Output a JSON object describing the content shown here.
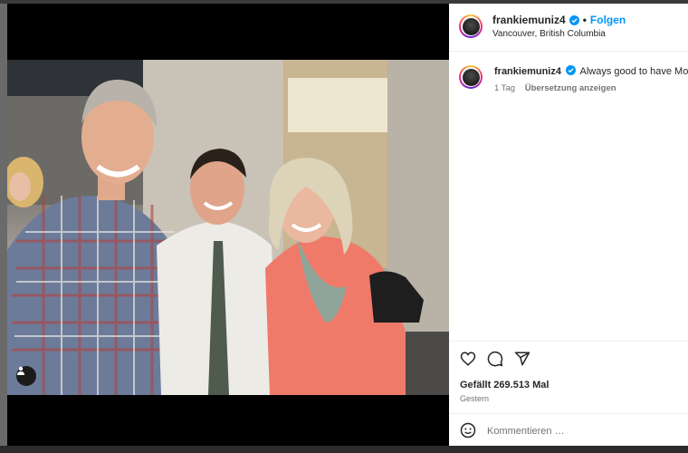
{
  "post": {
    "username": "frankiemuniz4",
    "separator": "•",
    "follow_label": "Folgen",
    "location": "Vancouver, British Columbia",
    "caption_text": "Always good to have Mom a",
    "caption_age": "1 Tag",
    "translate_label": "Übersetzung anzeigen",
    "likes": "Gefällt 269.513 Mal",
    "date": "Gestern",
    "comment_placeholder": "Kommentieren …"
  },
  "icons": {
    "verified": "verified-badge-icon",
    "like": "heart-icon",
    "comment": "comment-icon",
    "share": "send-icon",
    "emoji": "emoji-icon",
    "tag": "user-tag-icon"
  },
  "colors": {
    "accent": "#0095f6",
    "text": "#262626",
    "muted": "#737373"
  }
}
